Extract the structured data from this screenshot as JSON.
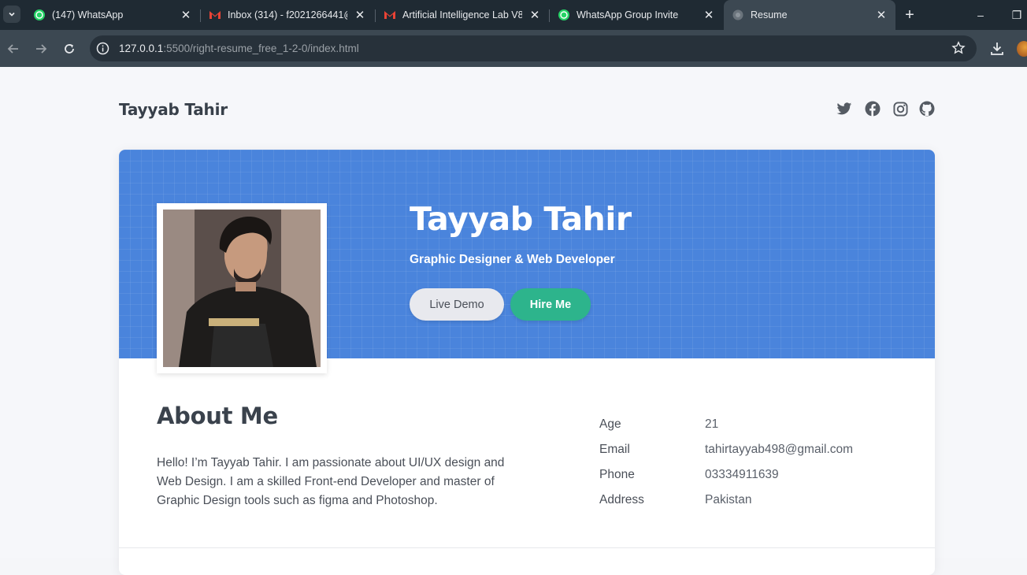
{
  "browser": {
    "tabs": [
      {
        "label": "(147) WhatsApp",
        "icon": "whatsapp-icon"
      },
      {
        "label": "Inbox (314) - f2021266441@",
        "icon": "gmail-icon"
      },
      {
        "label": "Artificial Intelligence Lab V8",
        "icon": "gmail-icon"
      },
      {
        "label": "WhatsApp Group Invite",
        "icon": "whatsapp-icon"
      },
      {
        "label": "Resume",
        "icon": "globe-icon",
        "active": true
      }
    ],
    "url_host": "127.0.0.1",
    "url_path": ":5500/right-resume_free_1-2-0/index.html"
  },
  "site": {
    "brand": "Tayyab Tahir",
    "social": [
      "twitter-icon",
      "facebook-icon",
      "instagram-icon",
      "github-icon"
    ]
  },
  "hero": {
    "name": "Tayyab Tahir",
    "title": "Graphic Designer & Web Developer",
    "demo_label": "Live Demo",
    "hire_label": "Hire Me"
  },
  "about": {
    "heading": "About Me",
    "text": "Hello! I’m Tayyab Tahir. I am passionate about UI/UX design and Web Design. I am a skilled Front-end Developer and master of Graphic Design tools such as figma and Photoshop.",
    "info": [
      {
        "key": "Age",
        "value": "21"
      },
      {
        "key": "Email",
        "value": "tahirtayyab498@gmail.com"
      },
      {
        "key": "Phone",
        "value": "03334911639"
      },
      {
        "key": "Address",
        "value": "Pakistan"
      }
    ]
  },
  "colors": {
    "hero_bg": "#4a84dc",
    "hire_button": "#2db48c",
    "browser_bg": "#1f2a33"
  }
}
